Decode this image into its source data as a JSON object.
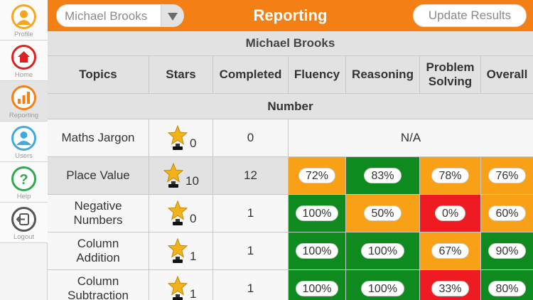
{
  "sidebar": {
    "items": [
      {
        "label": "Profile",
        "icon": "profile-icon",
        "color": "#f5a623"
      },
      {
        "label": "Home",
        "icon": "home-icon",
        "color": "#e02020"
      },
      {
        "label": "Reporting",
        "icon": "reporting-icon",
        "color": "#f47f14"
      },
      {
        "label": "Users",
        "icon": "users-icon",
        "color": "#3fa9e0"
      },
      {
        "label": "Help",
        "icon": "help-icon",
        "color": "#2fa84f"
      },
      {
        "label": "Logout",
        "icon": "logout-icon",
        "color": "#555555"
      }
    ],
    "active": "Reporting"
  },
  "header": {
    "selected_user": "Michael Brooks",
    "title": "Reporting",
    "update_button": "Update Results",
    "bg_color": "#f47f14"
  },
  "report": {
    "student_name": "Michael Brooks",
    "columns": [
      "Topics",
      "Stars",
      "Completed",
      "Fluency",
      "Reasoning",
      "Problem Solving",
      "Overall"
    ],
    "section": "Number",
    "rows": [
      {
        "topic": "Maths Jargon",
        "stars": "0",
        "completed": "0",
        "na_text": "N/A"
      },
      {
        "topic": "Place Value",
        "stars": "10",
        "completed": "12",
        "fluency": "72%",
        "reasoning": "83%",
        "problem_solving": "78%",
        "overall": "76%"
      },
      {
        "topic": "Negative Numbers",
        "stars": "0",
        "completed": "1",
        "fluency": "100%",
        "reasoning": "50%",
        "problem_solving": "0%",
        "overall": "60%"
      },
      {
        "topic": "Column Addition",
        "stars": "1",
        "completed": "1",
        "fluency": "100%",
        "reasoning": "100%",
        "problem_solving": "67%",
        "overall": "90%"
      },
      {
        "topic": "Column Subtraction",
        "stars": "1",
        "completed": "1",
        "fluency": "100%",
        "reasoning": "100%",
        "problem_solving": "33%",
        "overall": "80%"
      }
    ],
    "status_colors": {
      "green": "#0f8a1e",
      "orange": "#f9a116",
      "red": "#ee1b22"
    }
  }
}
